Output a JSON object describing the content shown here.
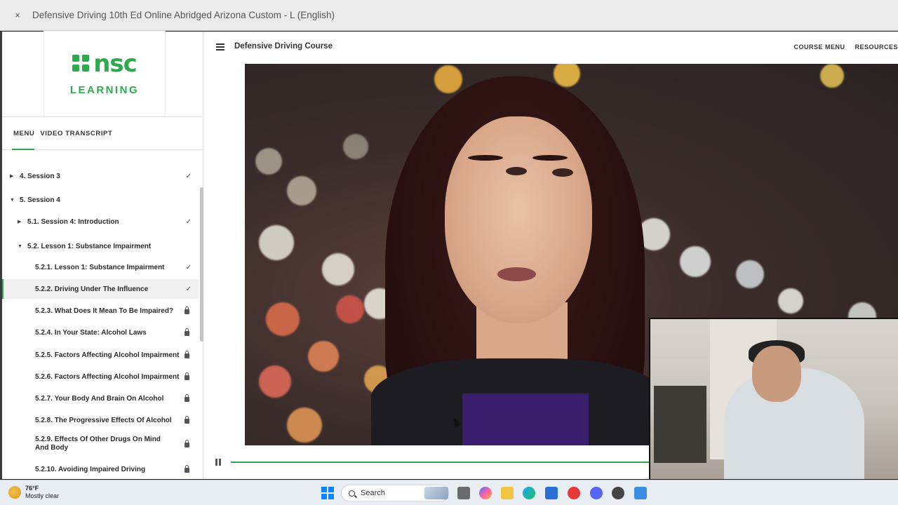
{
  "window": {
    "close_label": "×",
    "title": "Defensive Driving 10th Ed Online Abridged Arizona Custom - L (English)"
  },
  "logo": {
    "brand": "nsc",
    "sub": "LEARNING"
  },
  "sidebar": {
    "tabs": [
      "MENU",
      "VIDEO TRANSCRIPT"
    ],
    "items": [
      {
        "label": "4. Session 3",
        "status": "✓"
      },
      {
        "label": "5. Session 4",
        "status": ""
      },
      {
        "label": "5.1. Session 4: Introduction",
        "status": "✓"
      },
      {
        "label": "5.2. Lesson 1: Substance Impairment",
        "status": ""
      },
      {
        "label": "5.2.1. Lesson 1: Substance Impairment",
        "status": "✓"
      },
      {
        "label": "5.2.2. Driving Under The Influence",
        "status": "✓"
      },
      {
        "label": "5.2.3. What Does It Mean To Be Impaired?",
        "status": "locked"
      },
      {
        "label": "5.2.4. In Your State: Alcohol Laws",
        "status": "locked"
      },
      {
        "label": "5.2.5. Factors Affecting Alcohol Impairment",
        "status": "locked"
      },
      {
        "label": "5.2.6. Factors Affecting Alcohol Impairment",
        "status": "locked"
      },
      {
        "label": "5.2.7. Your Body And Brain On Alcohol",
        "status": "locked"
      },
      {
        "label": "5.2.8. The Progressive Effects Of Alcohol",
        "status": "locked"
      },
      {
        "label": "5.2.9. Effects Of Other Drugs On Mind And Body",
        "status": "locked"
      },
      {
        "label": "5.2.10. Avoiding Impaired Driving",
        "status": "locked"
      }
    ]
  },
  "header": {
    "course_title": "Defensive Driving Course",
    "links": [
      "COURSE MENU",
      "RESOURCES"
    ]
  },
  "player": {
    "progress": 1.0
  },
  "taskbar": {
    "temp": "76°F",
    "condition": "Mostly clear",
    "search": "Search"
  },
  "colors": {
    "accent": "#2fa84f",
    "titlebar": "#ebebeb",
    "taskbar": "#e8edf3"
  }
}
